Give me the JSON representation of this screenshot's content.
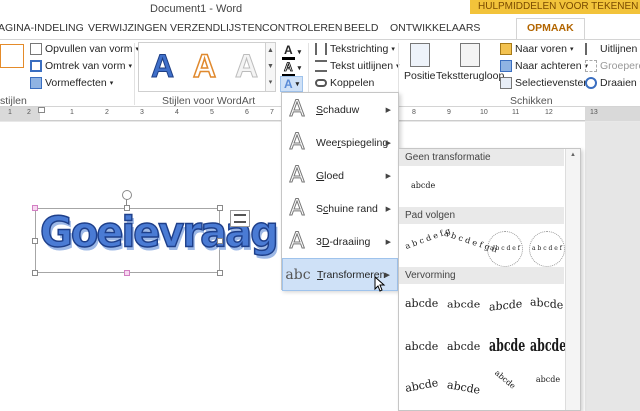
{
  "window": {
    "title": "Document1 - Word",
    "context_tab": "HULPMIDDELEN VOOR TEKENEN"
  },
  "tabs": [
    "AGINA-INDELING",
    "VERWIJZINGEN",
    "VERZENDLIJSTEN",
    "CONTROLEREN",
    "BEELD",
    "ONTWIKKELAARS",
    "OPMAAK"
  ],
  "ribbon": {
    "shape_styles": {
      "fill": "Opvullen van vorm",
      "outline": "Omtrek van vorm",
      "effects": "Vormeffecten",
      "group": "stijlen"
    },
    "wordart": {
      "group": "Stijlen voor WordArt",
      "glyph": "A"
    },
    "text": {
      "direction": "Tekstrichting",
      "align": "Tekst uitlijnen",
      "link": "Koppelen"
    },
    "arrange": {
      "position": "Positie",
      "wrap": "Tekstterugloop",
      "forward": "Naar voren",
      "backward": "Naar achteren",
      "selection_pane": "Selectievenster",
      "align": "Uitlijnen",
      "group": "Groeperen",
      "rotate": "Draaien",
      "group_label": "Schikken"
    }
  },
  "ruler": {
    "numbers": [
      "1",
      "2",
      "1",
      "2",
      "3",
      "4",
      "5",
      "6",
      "7",
      "8",
      "9",
      "10",
      "11",
      "12",
      "13"
    ]
  },
  "document": {
    "wordart_text": "Goeievraag"
  },
  "effects_menu": {
    "items": [
      {
        "label": "Schaduw",
        "key": "S"
      },
      {
        "label": "Weerspiegeling",
        "key": "r"
      },
      {
        "label": "Gloed",
        "key": "G"
      },
      {
        "label": "Schuine rand",
        "key": "c"
      },
      {
        "label": "3D-draaiing",
        "key": "D"
      },
      {
        "label": "Transformeren",
        "key": "T",
        "selected": true
      }
    ],
    "transform_icon": "abc"
  },
  "transform_submenu": {
    "sections": [
      "Geen transformatie",
      "Pad volgen",
      "Vervorming"
    ],
    "no_transform_sample": "abcde",
    "path_samples": [
      "a b c d e f g",
      "a b c d e f g h",
      "a b c d e f g h i j k l m",
      "a b c d e f g h i j k l m n o"
    ],
    "warp_samples": [
      "abcde",
      "abcde",
      "abcde",
      "abcde",
      "abcde",
      "abcde",
      "abcde",
      "abcde",
      "abcde",
      "abcde",
      "abcde",
      "abcde"
    ]
  }
}
